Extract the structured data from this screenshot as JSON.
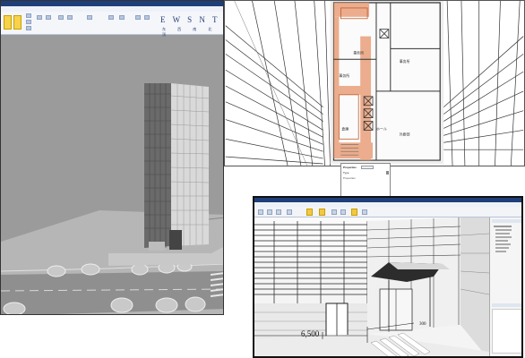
{
  "left_window": {
    "compass_letters": "E W S N T",
    "compass_sub": "东 西 南 北 顶"
  },
  "plan_window": {
    "rooms": [
      "事务所",
      "事务所",
      "事务所",
      "外廊部",
      "倉庫",
      "ホール"
    ]
  },
  "properties_popup": {
    "header": "Properties",
    "type_label": "Type",
    "section_label": "Properties"
  },
  "interior_window": {
    "dimension_left": "6,500",
    "dimension_right": "300"
  },
  "colors": {
    "title_bar": "#1e3f7a",
    "ribbon_accent": "#f7d24a",
    "plan_highlight": "#e07a3c"
  }
}
